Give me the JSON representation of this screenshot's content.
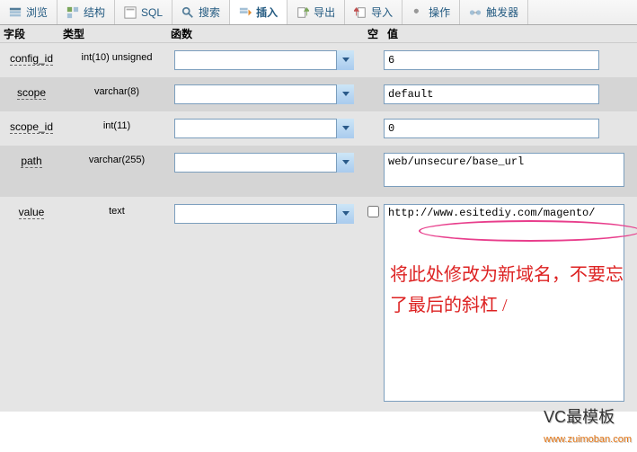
{
  "tabs": [
    {
      "icon": "browse",
      "label": "浏览"
    },
    {
      "icon": "structure",
      "label": "结构"
    },
    {
      "icon": "sql",
      "label": "SQL"
    },
    {
      "icon": "search",
      "label": "搜索"
    },
    {
      "icon": "insert",
      "label": "插入"
    },
    {
      "icon": "export",
      "label": "导出"
    },
    {
      "icon": "import",
      "label": "导入"
    },
    {
      "icon": "operations",
      "label": "操作"
    },
    {
      "icon": "triggers",
      "label": "触发器"
    }
  ],
  "headers": {
    "field": "字段",
    "type": "类型",
    "func": "函数",
    "null": "空",
    "value": "值"
  },
  "rows": [
    {
      "field": "config_id",
      "type": "int(10) unsigned",
      "value": "6",
      "null": false,
      "kind": "input"
    },
    {
      "field": "scope",
      "type": "varchar(8)",
      "value": "default",
      "null": false,
      "kind": "input"
    },
    {
      "field": "scope_id",
      "type": "int(11)",
      "value": "0",
      "null": false,
      "kind": "input"
    },
    {
      "field": "path",
      "type": "varchar(255)",
      "value": "web/unsecure/base_url",
      "null": false,
      "kind": "textarea"
    },
    {
      "field": "value",
      "type": "text",
      "value": "http://www.esitediy.com/magento/",
      "null": true,
      "kind": "bigtext"
    }
  ],
  "annotation": {
    "line1": "将此处修改为新域名，不要忘",
    "line2": "了最后的斜杠 /"
  },
  "watermark": {
    "main": "VC最模板",
    "sub": "www.zuimoban.com"
  }
}
